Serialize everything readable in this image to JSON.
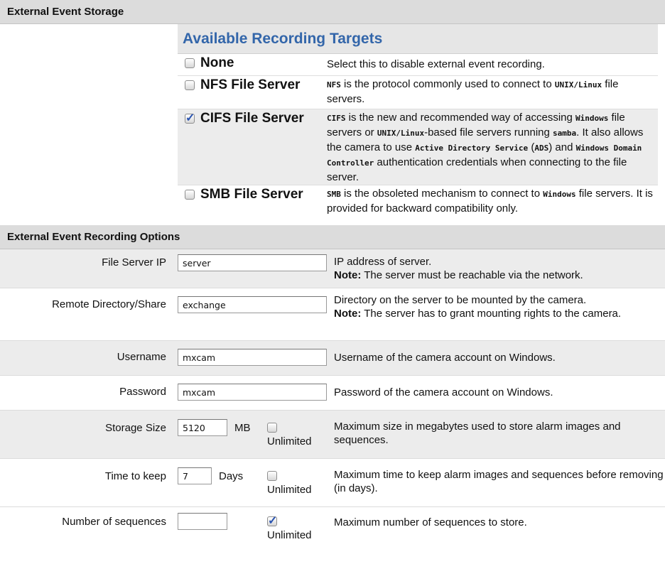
{
  "storage_section": {
    "title": "External Event Storage"
  },
  "targets": {
    "header": "Available Recording Targets",
    "items": [
      {
        "name": "None",
        "checked": false,
        "desc_parts": [
          {
            "t": "Select this to disable external event recording."
          }
        ]
      },
      {
        "name": "NFS File Server",
        "checked": false,
        "desc_parts": [
          {
            "m": "NFS"
          },
          {
            "t": " is the protocol commonly used to connect to "
          },
          {
            "m": "UNIX/Linux"
          },
          {
            "t": " file servers."
          }
        ]
      },
      {
        "name": "CIFS File Server",
        "checked": true,
        "desc_parts": [
          {
            "m": "CIFS"
          },
          {
            "t": " is the new and recommended way of accessing "
          },
          {
            "m": "Windows"
          },
          {
            "t": " file servers or "
          },
          {
            "m": "UNIX/Linux"
          },
          {
            "t": "-based file servers running "
          },
          {
            "m": "samba"
          },
          {
            "t": ". It also allows the camera to use "
          },
          {
            "m": "Active Directory Service"
          },
          {
            "t": " ("
          },
          {
            "m": "ADS"
          },
          {
            "t": ") and "
          },
          {
            "m": "Windows Domain Controller"
          },
          {
            "t": " authentication credentials when connecting to the file server."
          }
        ]
      },
      {
        "name": "SMB File Server",
        "checked": false,
        "desc_parts": [
          {
            "m": "SMB"
          },
          {
            "t": " is the obsoleted mechanism to connect to "
          },
          {
            "m": "Windows"
          },
          {
            "t": " file servers. It is provided for backward compatibility only."
          }
        ]
      }
    ]
  },
  "options_section": {
    "title": "External Event Recording Options"
  },
  "options": {
    "file_server_ip": {
      "label": "File Server IP",
      "value": "server",
      "desc": "IP address of server.",
      "note_label": "Note:",
      "note": " The server must be reachable via the network."
    },
    "remote_dir": {
      "label": "Remote Directory/Share",
      "value": "exchange",
      "desc": "Directory on the server to be mounted by the camera.",
      "note_label": "Note:",
      "note": " The server has to grant mounting rights to the camera."
    },
    "username": {
      "label": "Username",
      "value": "mxcam",
      "desc": "Username of the camera account on Windows."
    },
    "password": {
      "label": "Password",
      "value": "mxcam",
      "desc": "Password of the camera account on Windows."
    },
    "storage_size": {
      "label": "Storage Size",
      "value": "5120",
      "unit": "MB",
      "unlimited_label": "Unlimited",
      "unlimited": false,
      "desc": "Maximum size in megabytes used to store alarm images and sequences."
    },
    "time_to_keep": {
      "label": "Time to keep",
      "value": "7",
      "unit": "Days",
      "unlimited_label": "Unlimited",
      "unlimited": false,
      "desc": "Maximum time to keep alarm images and sequences before removing (in days)."
    },
    "num_sequences": {
      "label": "Number of sequences",
      "value": "",
      "unlimited_label": "Unlimited",
      "unlimited": true,
      "desc": "Maximum number of sequences to store."
    }
  }
}
